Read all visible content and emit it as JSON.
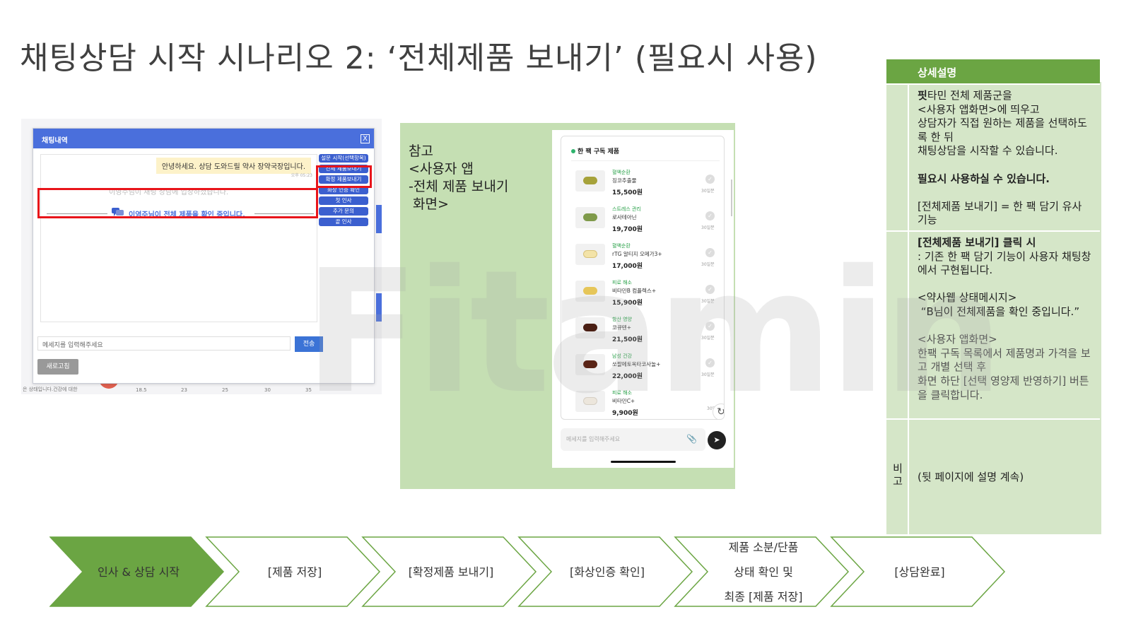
{
  "slide": {
    "title": "채팅상담 시작 시나리오 2: ‘전체제품 보내기’ (필요시 사용)",
    "watermark": "Fitamin"
  },
  "web_screenshot": {
    "window_title": "채팅내역",
    "close_label": "X",
    "greeting": "안녕하세요. 상담 도와드릴 약사 장약국장입니다.",
    "greeting_time": "오후 05:23",
    "faded_text": "이영주님이 채팅 상담에 입장하셨습니다.",
    "status_message": "이영주님이 전체 제품을 확인 중입니다.",
    "side_buttons": [
      {
        "label": "설문 시작(선택항목)"
      },
      {
        "label": "전체 제품보내기"
      },
      {
        "label": "확정 제품보내기"
      },
      {
        "label": "화상 인증 확인"
      },
      {
        "label": "첫 인사"
      },
      {
        "label": "추가 문의"
      },
      {
        "label": "끝 인사"
      }
    ],
    "input_placeholder": "메세지를 입력해주세요",
    "send_label": "전송",
    "refresh_label": "새로고침",
    "bg_caption": "은 상태입니다.건강에 대한",
    "bg_ticks": [
      "18.5",
      "23",
      "25",
      "30",
      "35"
    ]
  },
  "reference": {
    "text_lines": [
      "참고",
      "<사용자 앱",
      "-전체 제품 보내기",
      " 화면>"
    ],
    "phone": {
      "section_title": "한 팩 구독 제품",
      "products": [
        {
          "category": "혈액순환",
          "name": "징코추출물",
          "price": "15,500원",
          "days": "30일분",
          "pill_color": "#a6a23a"
        },
        {
          "category": "스트레스 관리",
          "name": "로사테아닌",
          "price": "19,700원",
          "days": "30일분",
          "pill_color": "#7f9a4a"
        },
        {
          "category": "혈액순환",
          "name": "rTG 알티지 오메가3+",
          "price": "17,000원",
          "days": "30일분",
          "pill_color": "#f3e3a8"
        },
        {
          "category": "피로 해소",
          "name": "비타민B 컴플렉스+",
          "price": "15,900원",
          "days": "30일분",
          "pill_color": "#e6c659"
        },
        {
          "category": "항산 영양",
          "name": "코큐텐+",
          "price": "21,500원",
          "days": "30일분",
          "pill_color": "#4a1f14"
        },
        {
          "category": "남성 건강",
          "name": "쏘팔메토옥타코사놀+",
          "price": "22,000원",
          "days": "30일분",
          "pill_color": "#5a2416"
        },
        {
          "category": "피로 해소",
          "name": "비타민C+",
          "price": "9,900원",
          "days": "30일분",
          "pill_color": "#ece6dc"
        }
      ],
      "input_placeholder": "메세지를 입력해주세요"
    }
  },
  "description": {
    "header": "상세설명",
    "row1": {
      "bold_prefix": "핏",
      "text": "타민 전체 제품군을\n<사용자 앱화면>에 띄우고\n상담자가 직접 원하는 제품을 선택하도록 한 뒤\n채팅상담을 시작할 수 있습니다.",
      "bold_line": "필요시 사용하실 수 있습니다.",
      "text2": "[전체제품 보내기] = 한 팩 담기 유사 기능"
    },
    "row2": {
      "bold_line": "[전체제품 보내기] 클릭 시",
      "text": ": 기존 한 팩 담기 기능이 사용자 채팅창에서 구현됩니다.\n\n<약사웹 상태메시지>\n “B님이 전체제품을 확인 중입니다.”",
      "gray_text": "<사용자 앱화면>\n한팩 구독 목록에서 제품명과 가격을 보고 개별 선택 후\n화면 하단 [선택 영양제 반영하기] 버튼을 클릭합니다."
    },
    "row3": {
      "label": "비고",
      "text": "(뒷 페이지에 설명 계속)"
    }
  },
  "process": {
    "steps": [
      {
        "lines": [
          "인사 & 상담 시작"
        ],
        "active": true
      },
      {
        "lines": [
          "[제품 저장]"
        ],
        "active": false
      },
      {
        "lines": [
          "[확정제품 보내기]"
        ],
        "active": false
      },
      {
        "lines": [
          "[화상인증 확인]"
        ],
        "active": false
      },
      {
        "lines": [
          "제품 소분/단품",
          "상태 확인 및",
          "최종 [제품 저장]"
        ],
        "active": false
      },
      {
        "lines": [
          "[상담완료]"
        ],
        "active": false
      }
    ],
    "active_color": "#6ba543",
    "border_color": "#6ba543"
  }
}
